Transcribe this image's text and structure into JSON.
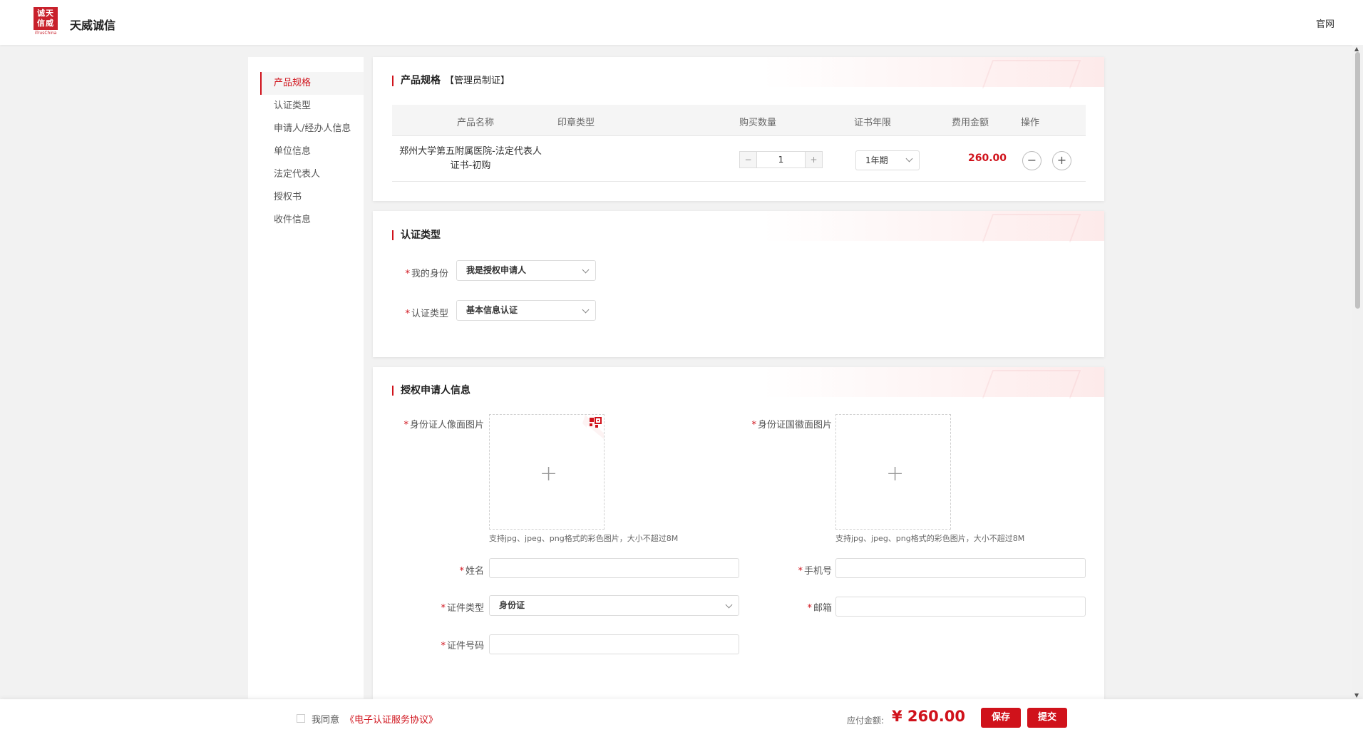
{
  "header": {
    "logo_text": "诚天信威",
    "logo_sub": "iTrusChina",
    "brand": "天威诚信",
    "official_link": "官网"
  },
  "sidebar": {
    "items": [
      {
        "label": "产品规格",
        "active": true
      },
      {
        "label": "认证类型"
      },
      {
        "label": "申请人/经办人信息"
      },
      {
        "label": "单位信息"
      },
      {
        "label": "法定代表人"
      },
      {
        "label": "授权书"
      },
      {
        "label": "收件信息"
      }
    ]
  },
  "product": {
    "title": "产品规格",
    "subtitle": "【管理员制证】",
    "columns": [
      "产品名称",
      "印章类型",
      "购买数量",
      "证书年限",
      "费用金额",
      "操作"
    ],
    "row": {
      "name": "郑州大学第五附属医院-法定代表人证书-初购",
      "quantity": "1",
      "years": "1年期",
      "amount": "260.00"
    },
    "stepper_minus": "−",
    "stepper_plus": "+",
    "remove_icon": "−",
    "add_icon": "+"
  },
  "auth_type": {
    "title": "认证类型",
    "identity_label": "我的身份",
    "identity_value": "我是授权申请人",
    "type_label": "认证类型",
    "type_value": "基本信息认证"
  },
  "applicant": {
    "title": "授权申请人信息",
    "front_label": "身份证人像面图片",
    "back_label": "身份证国徽面图片",
    "upload_hint": "支持jpg、jpeg、png格式的彩色图片，大小不超过8M",
    "name_label": "姓名",
    "phone_label": "手机号",
    "idtype_label": "证件类型",
    "idtype_value": "身份证",
    "email_label": "邮箱",
    "idno_label": "证件号码"
  },
  "footer": {
    "agree_text": "我同意",
    "agree_link": "《电子认证服务协议》",
    "pay_label": "应付金额:",
    "pay_amount": "¥ 260.00",
    "save": "保存",
    "submit": "提交"
  },
  "colors": {
    "accent": "#d0121b",
    "background": "#f2f2f2"
  }
}
